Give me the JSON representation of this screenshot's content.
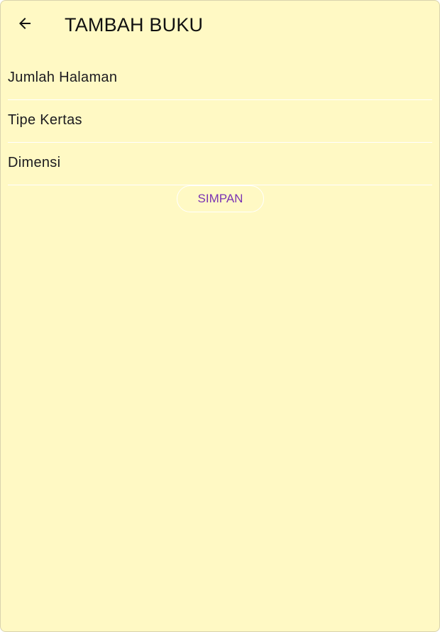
{
  "app_bar": {
    "title": "TAMBAH BUKU",
    "back_icon": "arrow-back-icon"
  },
  "form": {
    "fields": [
      {
        "label": "Jumlah Halaman",
        "value": ""
      },
      {
        "label": "Tipe Kertas",
        "value": ""
      },
      {
        "label": "Dimensi",
        "value": ""
      }
    ],
    "save_label": "SIMPAN"
  },
  "colors": {
    "background": "#fff9c4",
    "accent": "#7b34b3",
    "text": "#1c1b1f",
    "divider": "#ffffff"
  }
}
